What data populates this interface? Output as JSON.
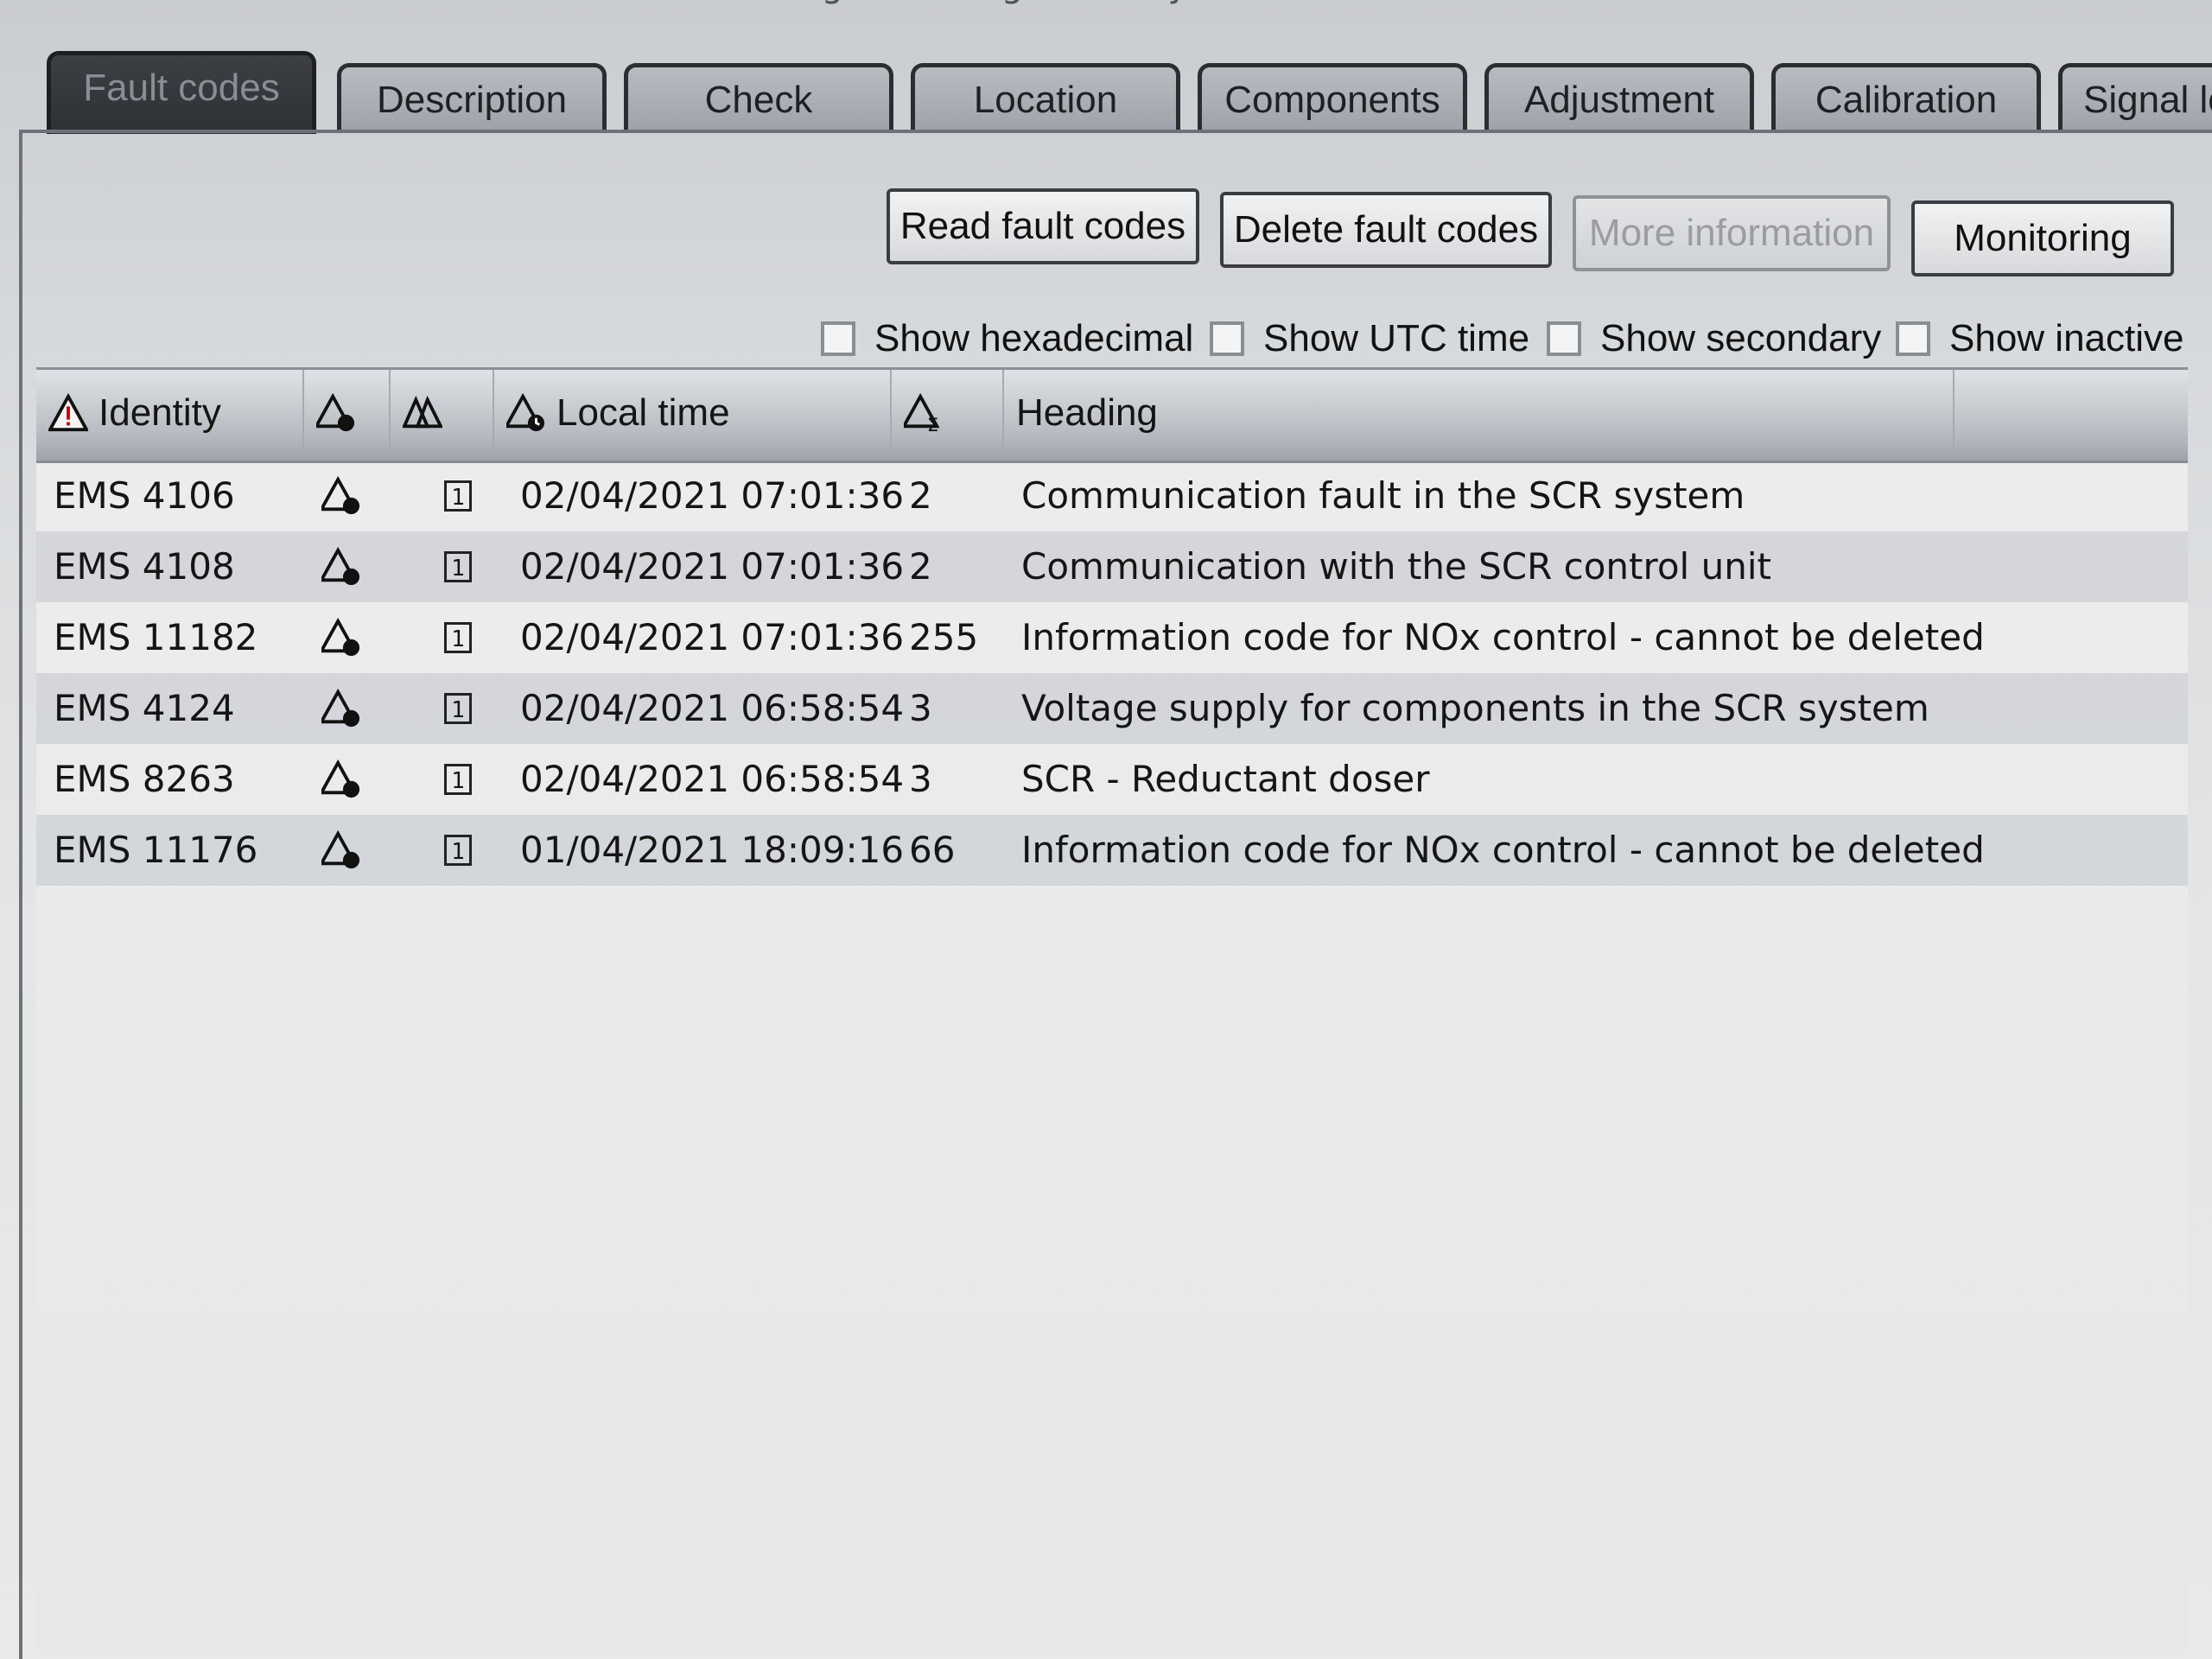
{
  "window": {
    "title": "Engine Management System"
  },
  "tabs": [
    {
      "label": "Fault codes",
      "active": true
    },
    {
      "label": "Description",
      "active": false
    },
    {
      "label": "Check",
      "active": false
    },
    {
      "label": "Location",
      "active": false
    },
    {
      "label": "Components",
      "active": false
    },
    {
      "label": "Adjustment",
      "active": false
    },
    {
      "label": "Calibration",
      "active": false
    },
    {
      "label": "Signal log",
      "active": false
    }
  ],
  "toolbar": {
    "read_label": "Read fault codes",
    "delete_label": "Delete fault codes",
    "more_label": "More information",
    "monitor_label": "Monitoring"
  },
  "options": {
    "hex_label": "Show hexadecimal",
    "utc_label": "Show UTC time",
    "secondary_label": "Show secondary",
    "inactive_label": "Show inactive"
  },
  "columns": {
    "identity": "Identity",
    "local_time": "Local time",
    "heading": "Heading"
  },
  "rows": [
    {
      "identity": "EMS 4106",
      "status": "1",
      "time": "02/04/2021 07:01:36",
      "count": "2",
      "heading": "Communication fault in the SCR system"
    },
    {
      "identity": "EMS 4108",
      "status": "1",
      "time": "02/04/2021 07:01:36",
      "count": "2",
      "heading": "Communication with the SCR control unit"
    },
    {
      "identity": "EMS 11182",
      "status": "1",
      "time": "02/04/2021 07:01:36",
      "count": "255",
      "heading": "Information code for NOx control - cannot be deleted"
    },
    {
      "identity": "EMS 4124",
      "status": "1",
      "time": "02/04/2021 06:58:54",
      "count": "3",
      "heading": "Voltage supply for components in the SCR system"
    },
    {
      "identity": "EMS 8263",
      "status": "1",
      "time": "02/04/2021 06:58:54",
      "count": "3",
      "heading": "SCR - Reductant doser"
    },
    {
      "identity": "EMS 11176",
      "status": "1",
      "time": "01/04/2021 18:09:16",
      "count": "66",
      "heading": "Information code for NOx control - cannot be deleted"
    }
  ],
  "colors": {
    "tab_active": "#2d3035",
    "tab_inactive": "#9ea3aa",
    "header_bg": "#b8bcc2",
    "row_alt": "#c4c8ce"
  }
}
